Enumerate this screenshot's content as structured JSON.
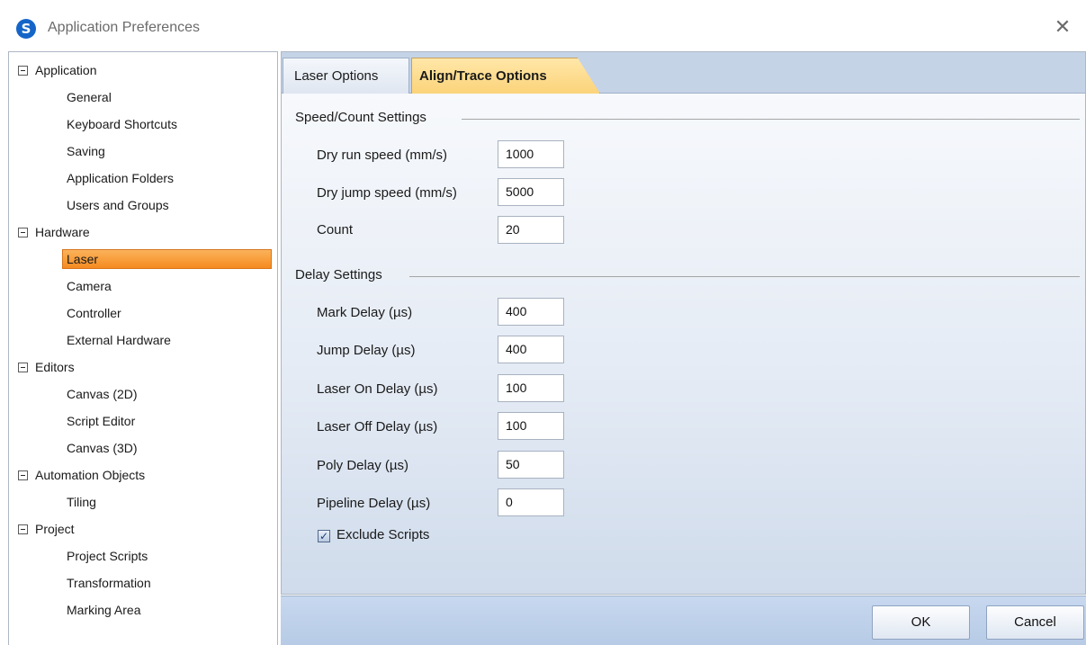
{
  "window": {
    "title": "Application Preferences",
    "app_icon": "S",
    "close_glyph": "✕"
  },
  "tree": {
    "groups": [
      {
        "label": "Application",
        "children": [
          "General",
          "Keyboard Shortcuts",
          "Saving",
          "Application Folders",
          "Users and Groups"
        ]
      },
      {
        "label": "Hardware",
        "children": [
          "Laser",
          "Camera",
          "Controller",
          "External Hardware"
        ]
      },
      {
        "label": "Editors",
        "children": [
          "Canvas (2D)",
          "Script Editor",
          "Canvas (3D)"
        ]
      },
      {
        "label": "Automation Objects",
        "children": [
          "Tiling"
        ]
      },
      {
        "label": "Project",
        "children": [
          "Project Scripts",
          "Transformation",
          "Marking Area"
        ]
      }
    ],
    "selected": "Laser"
  },
  "tabs": [
    {
      "label": "Laser Options",
      "active": false
    },
    {
      "label": "Align/Trace Options",
      "active": true
    }
  ],
  "speed": {
    "header": "Speed/Count Settings",
    "fields": [
      {
        "label": "Dry run speed (mm/s)",
        "value": "1000"
      },
      {
        "label": "Dry jump speed (mm/s)",
        "value": "5000"
      },
      {
        "label": "Count",
        "value": "20"
      }
    ]
  },
  "delay": {
    "header": "Delay Settings",
    "fields": [
      {
        "label": "Mark Delay (µs)",
        "value": "400"
      },
      {
        "label": "Jump Delay (µs)",
        "value": "400"
      },
      {
        "label": "Laser On Delay (µs)",
        "value": "100"
      },
      {
        "label": "Laser Off Delay (µs)",
        "value": "100"
      },
      {
        "label": "Poly Delay (µs)",
        "value": "50"
      },
      {
        "label": "Pipeline Delay (µs)",
        "value": "0"
      }
    ]
  },
  "exclude_scripts": {
    "label": "Exclude Scripts",
    "checked": true,
    "check_glyph": "✓"
  },
  "buttons": {
    "ok": "OK",
    "cancel": "Cancel"
  },
  "colors": {
    "selection": "#f58a1f",
    "active_tab": "#fbd37a",
    "panel_blue": "#c7d5e8"
  }
}
